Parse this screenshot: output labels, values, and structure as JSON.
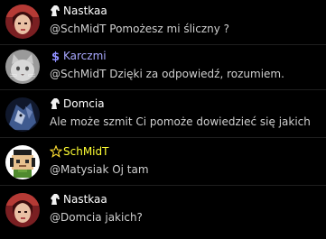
{
  "colors": {
    "background": "#000000",
    "text": "#cfcfcf",
    "default_user": "#ffffff",
    "karczmi_user": "#a8a8ff",
    "schmidt_user": "#ffff33"
  },
  "messages": [
    {
      "author": "Nastkaa",
      "author_color": "#ffffff",
      "role_icon": "horse-head-icon",
      "avatar": "red-portrait-avatar",
      "text": "@SchMidT Pomożesz mi śliczny ?"
    },
    {
      "author": "Karczmi",
      "author_color": "#a8a8ff",
      "role_icon": "dollar-sign-icon",
      "avatar": "grey-cat-avatar",
      "text": "@SchMidT Dzięki za odpowiedź, rozumiem."
    },
    {
      "author": "Domcia",
      "author_color": "#ffffff",
      "role_icon": "horse-head-icon",
      "avatar": "blue-figure-avatar",
      "text": "Ale może szmit Ci pomoże dowiedzieć się jakich"
    },
    {
      "author": "SchMidT",
      "author_color": "#ffff33",
      "role_icon": "star-icon",
      "avatar": "pixel-character-avatar",
      "text": "@Matysiak Oj tam"
    },
    {
      "author": "Nastkaa",
      "author_color": "#ffffff",
      "role_icon": "horse-head-icon",
      "avatar": "red-portrait-avatar",
      "text": "@Domcia jakich?"
    }
  ]
}
